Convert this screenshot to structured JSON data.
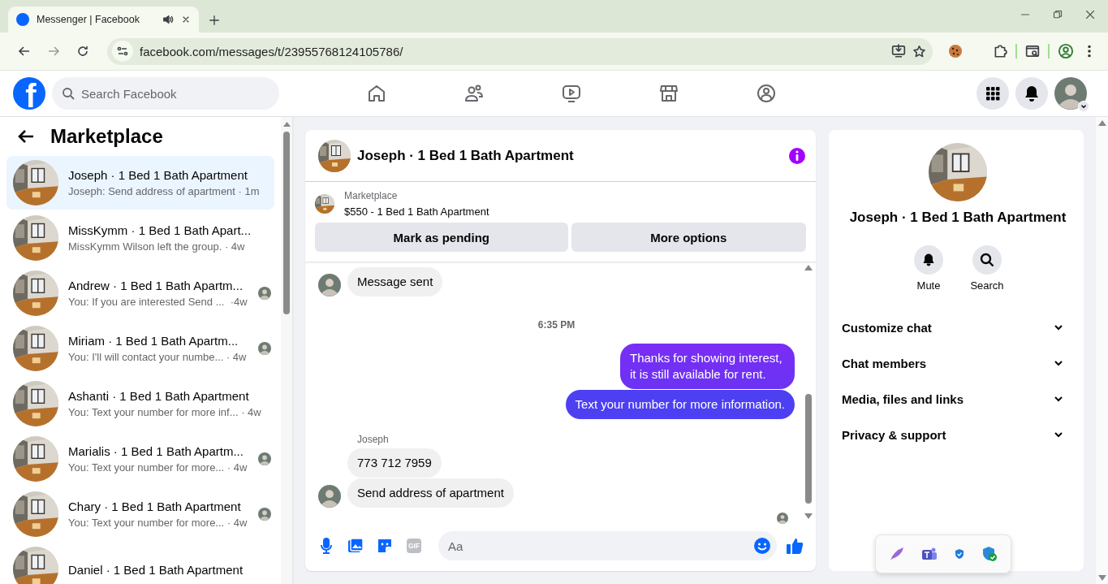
{
  "browser": {
    "tab_title": "Messenger | Facebook",
    "url": "facebook.com/messages/t/23955768124105786/"
  },
  "header": {
    "logo": "f",
    "search_placeholder": "Search Facebook"
  },
  "sidebar": {
    "title": "Marketplace",
    "conversations": [
      {
        "name": "Joseph · 1 Bed 1 Bath Apartment",
        "preview": "Joseph: Send address of apartment · 1m",
        "selected": true,
        "seen": false
      },
      {
        "name": "MissKymm · 1 Bed 1 Bath Apart...",
        "preview": "MissKymm Wilson left the group. · 4w",
        "selected": false,
        "seen": false
      },
      {
        "name": "Andrew · 1 Bed 1 Bath Apartm...",
        "preview": "You: If you are interested Send ...  ·4w",
        "selected": false,
        "seen": true
      },
      {
        "name": "Miriam · 1 Bed 1 Bath Apartm...",
        "preview": "You: I'll will contact your numbe... · 4w",
        "selected": false,
        "seen": true
      },
      {
        "name": "Ashanti · 1 Bed 1 Bath Apartment",
        "preview": "You: Text your number for more inf... · 4w",
        "selected": false,
        "seen": false
      },
      {
        "name": "Marialis · 1 Bed 1 Bath Apartm...",
        "preview": "You: Text your number for more... · 4w",
        "selected": false,
        "seen": true
      },
      {
        "name": "Chary · 1 Bed 1 Bath Apartment",
        "preview": "You: Text your number for more... · 4w",
        "selected": false,
        "seen": true
      },
      {
        "name": "Daniel · 1 Bed 1 Bath Apartment",
        "selected": false,
        "seen": false
      }
    ]
  },
  "chat": {
    "title": "Joseph · 1 Bed 1 Bath Apartment",
    "listing": {
      "label": "Marketplace",
      "item": "$550 - 1 Bed 1 Bath Apartment",
      "buttons": [
        "Mark as pending",
        "More options"
      ]
    },
    "messages": [
      {
        "kind": "incoming",
        "text": "Message sent",
        "avatar": true
      },
      {
        "kind": "time",
        "text": "6:35 PM"
      },
      {
        "kind": "outgoing",
        "text": "Thanks for showing interest, it is still available for rent."
      },
      {
        "kind": "outgoing",
        "text": "Text your number for more information."
      },
      {
        "kind": "sender",
        "text": "Joseph"
      },
      {
        "kind": "incoming",
        "text": "773 712 7959",
        "avatar": false
      },
      {
        "kind": "incoming",
        "text": "Send address of apartment",
        "avatar": true
      }
    ],
    "composer": {
      "gif_label": "GIF",
      "placeholder": "Aa"
    }
  },
  "info": {
    "title": "Joseph · 1 Bed 1 Bath Apartment",
    "actions": [
      "Mute",
      "Search"
    ],
    "sections": [
      "Customize chat",
      "Chat members",
      "Media, files and links",
      "Privacy & support"
    ]
  }
}
